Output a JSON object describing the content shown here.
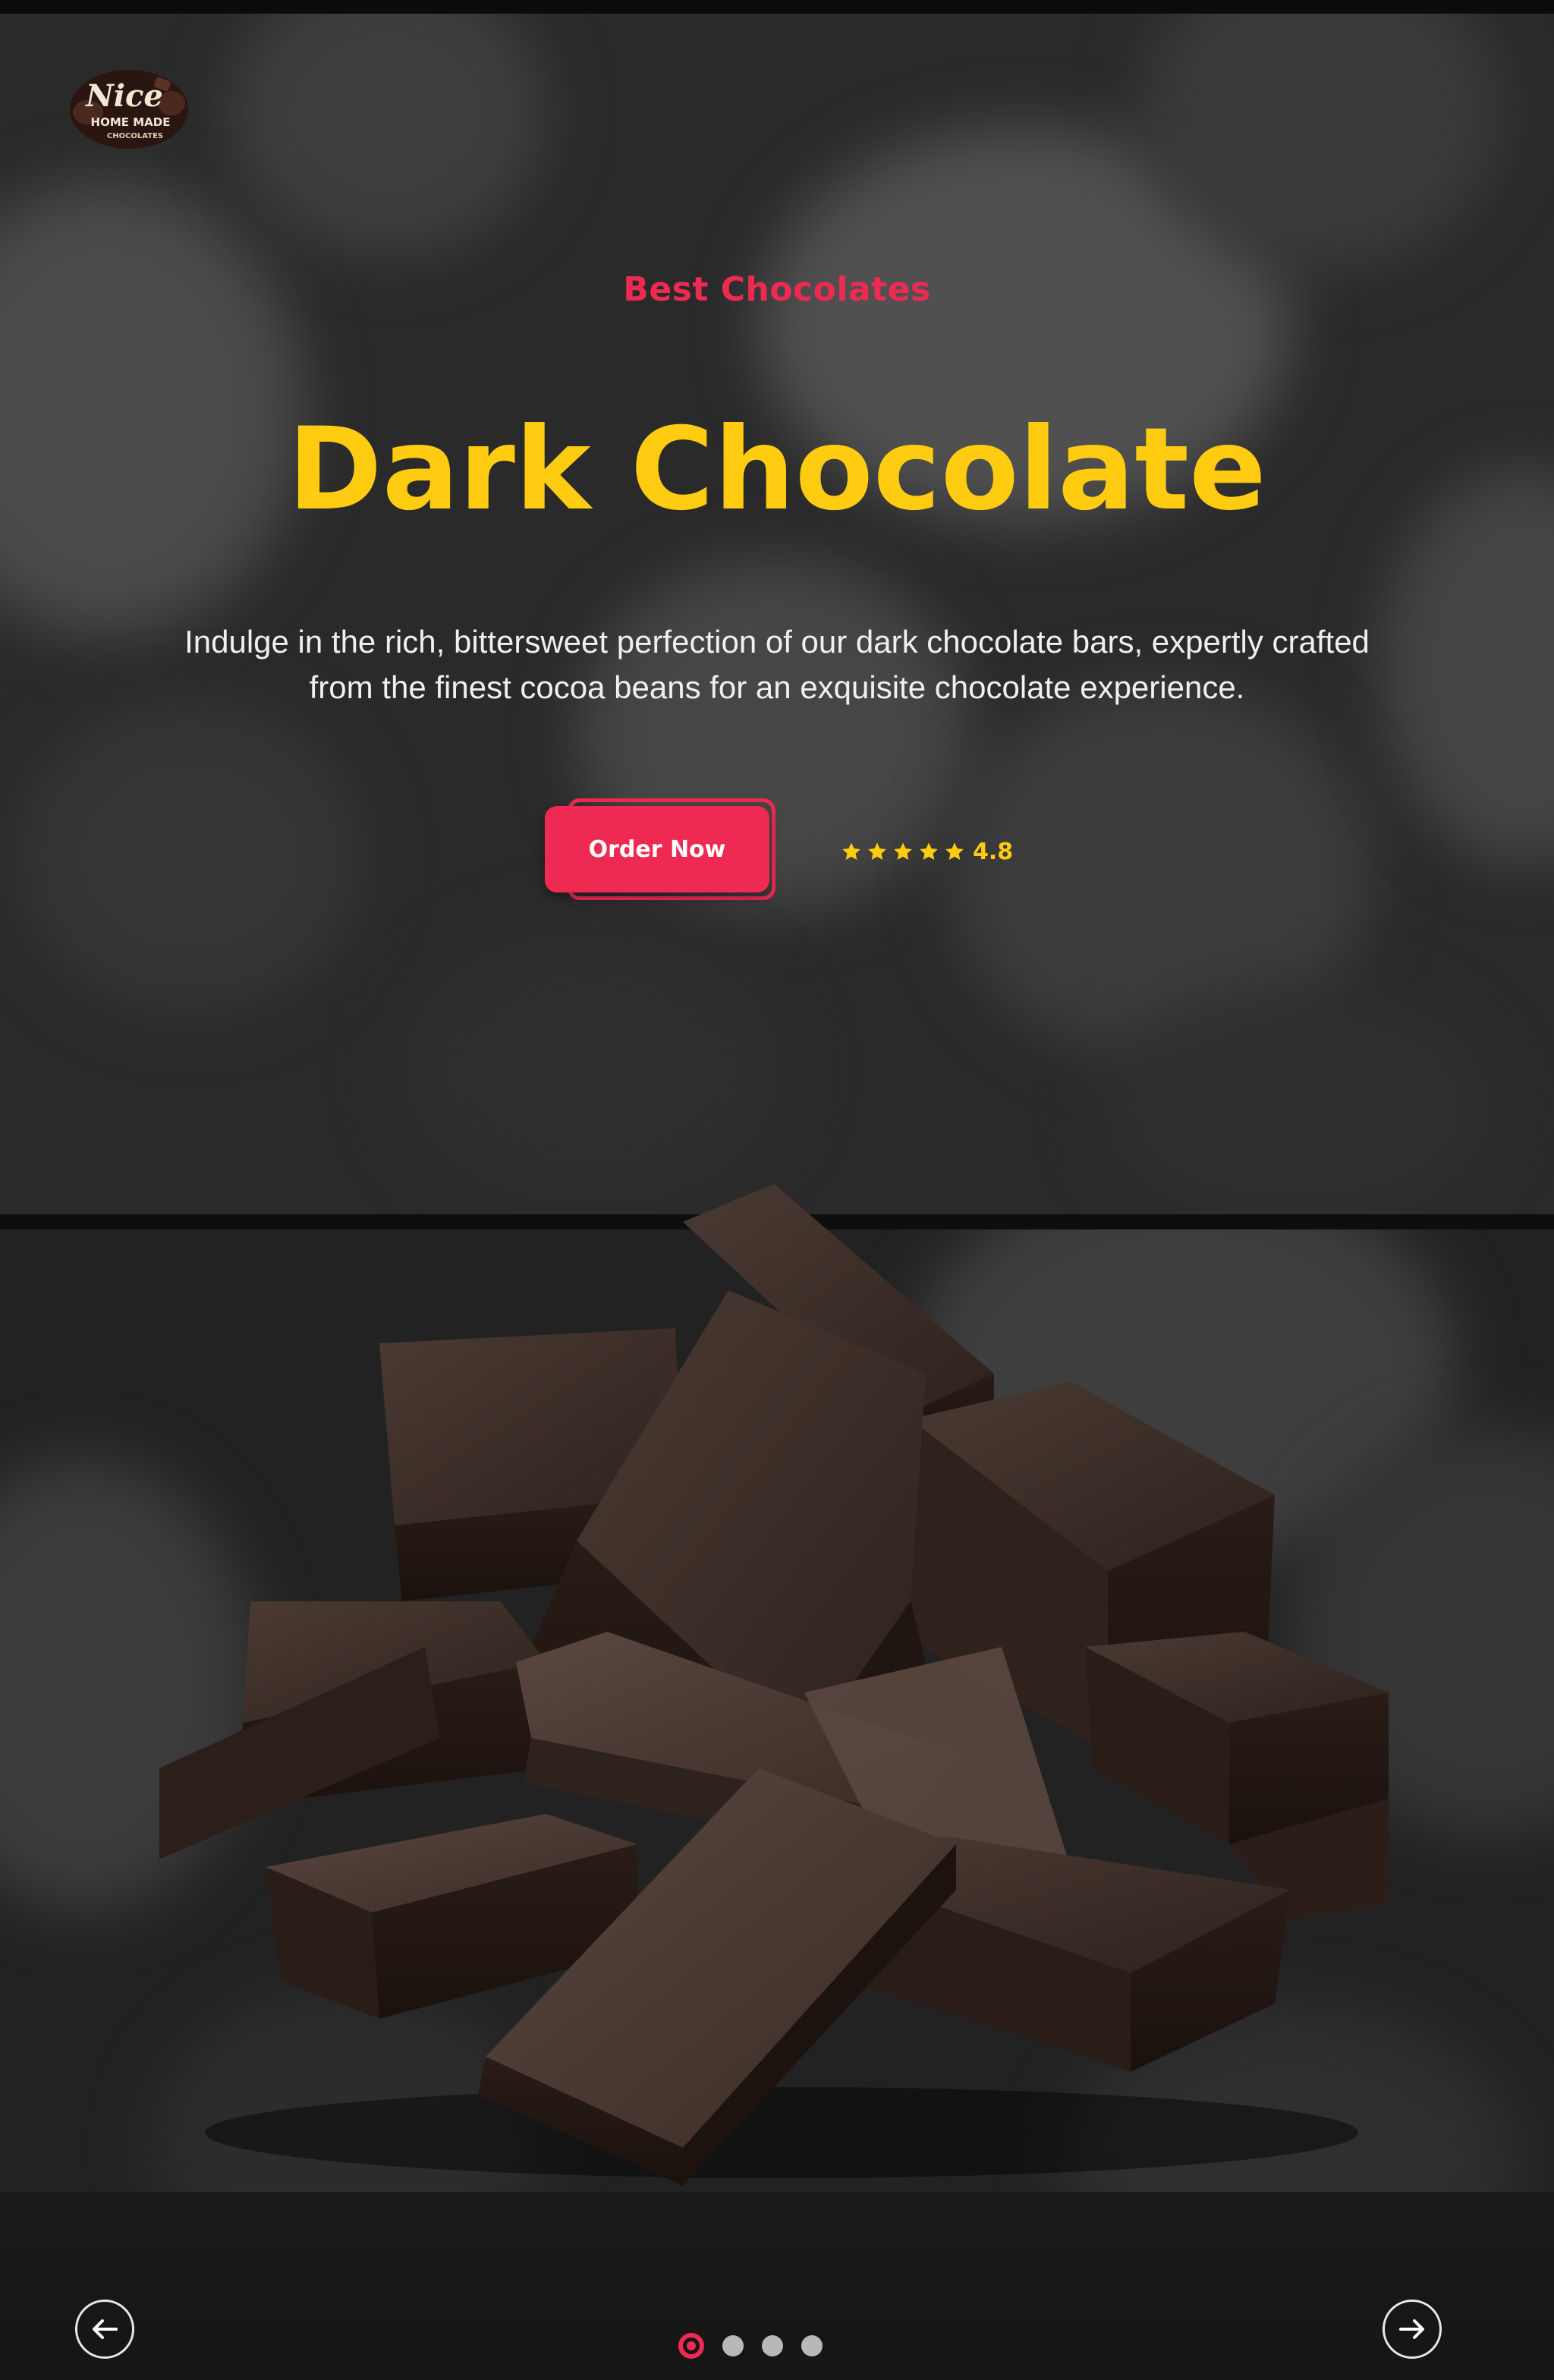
{
  "brand": {
    "logo_line1": "Nice",
    "logo_line2": "HOME MADE",
    "logo_line3": "CHOCOLATES"
  },
  "hero": {
    "eyebrow": "Best Chocolates",
    "title": "Dark Chocolate",
    "description": "Indulge in the rich, bittersweet perfection of our dark chocolate bars, expertly crafted from the finest cocoa beans for an exquisite chocolate experience.",
    "cta_label": "Order Now",
    "rating": {
      "stars": 5,
      "value": "4.8"
    }
  },
  "carousel": {
    "slide_count": 4,
    "active_index": 0,
    "prev_icon": "arrow-left-icon",
    "next_icon": "arrow-right-icon"
  },
  "colors": {
    "accent": "#ef2a52",
    "title": "#ffcc11",
    "background": "#1c1c1c",
    "text": "#f0f0f0"
  }
}
